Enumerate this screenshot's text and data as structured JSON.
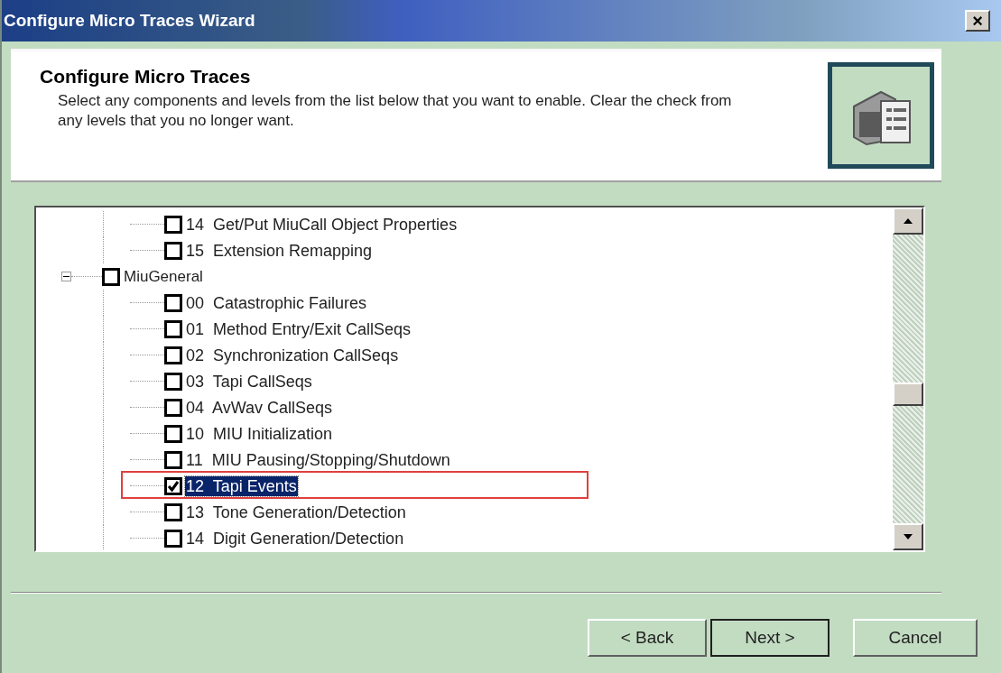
{
  "window": {
    "title": "Configure Micro Traces Wizard",
    "close": "×"
  },
  "header": {
    "title": "Configure Micro Traces",
    "description": "Select any components and levels from the list below that you want to enable.  Clear the check from any levels that you no longer want."
  },
  "tree": {
    "items": [
      {
        "children": [
          {
            "label": "14  Get/Put MiuCall Object Properties",
            "checked": false,
            "selected": false,
            "marked": false
          },
          {
            "label": "15  Extension Remapping",
            "checked": false,
            "selected": false,
            "marked": false
          }
        ]
      },
      {
        "label": "MiuGeneral",
        "checked": false,
        "selected": false,
        "marked": false,
        "expanded": true,
        "children": [
          {
            "label": "00  Catastrophic Failures",
            "checked": false,
            "selected": false,
            "marked": false
          },
          {
            "label": "01  Method Entry/Exit CallSeqs",
            "checked": false,
            "selected": false,
            "marked": false
          },
          {
            "label": "02  Synchronization CallSeqs",
            "checked": false,
            "selected": false,
            "marked": false
          },
          {
            "label": "03  Tapi CallSeqs",
            "checked": false,
            "selected": false,
            "marked": false
          },
          {
            "label": "04  AvWav CallSeqs",
            "checked": false,
            "selected": false,
            "marked": false
          },
          {
            "label": "10  MIU Initialization",
            "checked": false,
            "selected": false,
            "marked": false
          },
          {
            "label": "11  MIU Pausing/Stopping/Shutdown",
            "checked": false,
            "selected": false,
            "marked": false
          },
          {
            "label": "12  Tapi Events",
            "checked": true,
            "selected": true,
            "marked": true
          },
          {
            "label": "13  Tone Generation/Detection",
            "checked": false,
            "selected": false,
            "marked": false
          },
          {
            "label": "14  Digit Generation/Detection",
            "checked": false,
            "selected": false,
            "marked": false
          }
        ]
      }
    ]
  },
  "buttons": [
    {
      "label": "< Back",
      "default": false
    },
    {
      "label": "Next >",
      "default": true
    },
    {
      "label": "Cancel",
      "default": false
    }
  ]
}
